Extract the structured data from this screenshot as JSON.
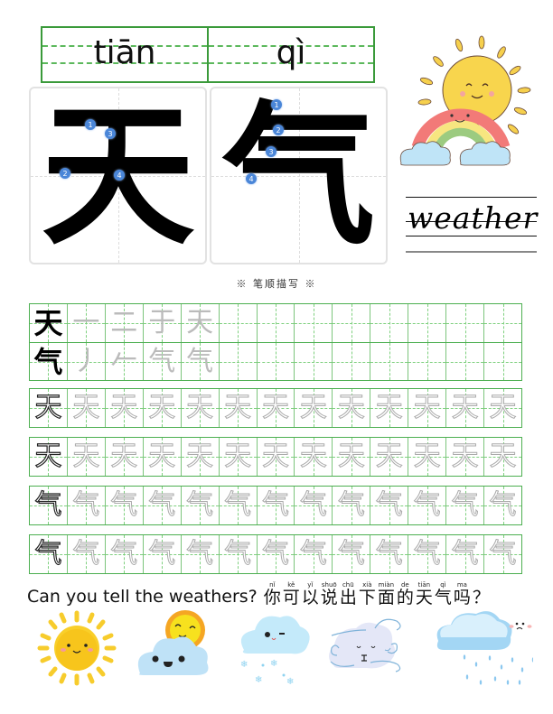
{
  "header": {
    "pinyin": [
      "tiān",
      "qì"
    ]
  },
  "stroke_order": {
    "characters": [
      {
        "char": "天",
        "badges": [
          "1",
          "2",
          "3",
          "4"
        ]
      },
      {
        "char": "气",
        "badges": [
          "1",
          "2",
          "3",
          "4"
        ]
      }
    ],
    "note": "※ 笔顺描写 ※"
  },
  "illustration": {
    "top_right": "sun-over-rainbow-with-clouds"
  },
  "english_word": "weather",
  "practice": {
    "stroke_rows": [
      {
        "char": "天",
        "steps": [
          "一",
          "二",
          "于",
          "天"
        ]
      },
      {
        "char": "气",
        "steps": [
          "丿",
          "𠂉",
          "气",
          "气"
        ]
      }
    ],
    "trace_rows": [
      {
        "char": "天",
        "cells": 13
      },
      {
        "char": "天",
        "cells": 13
      },
      {
        "char": "气",
        "cells": 13
      },
      {
        "char": "气",
        "cells": 13
      }
    ],
    "columns": 13
  },
  "question": {
    "english": "Can you tell the weathers?",
    "chinese": [
      {
        "hz": "你",
        "py": "nǐ"
      },
      {
        "hz": "可",
        "py": "kě"
      },
      {
        "hz": "以",
        "py": "yǐ"
      },
      {
        "hz": "说",
        "py": "shuō"
      },
      {
        "hz": "出",
        "py": "chū"
      },
      {
        "hz": "下",
        "py": "xià"
      },
      {
        "hz": "面",
        "py": "miàn"
      },
      {
        "hz": "的",
        "py": "de"
      },
      {
        "hz": "天",
        "py": "tiān"
      },
      {
        "hz": "气",
        "py": "qì"
      },
      {
        "hz": "吗",
        "py": "ma"
      }
    ],
    "end_mark": "？"
  },
  "weather_icons": [
    "sunny",
    "partly-cloudy",
    "snowy",
    "windy",
    "rainy"
  ],
  "colors": {
    "grid_green": "#4caf50",
    "grid_dashed": "#7fd07f",
    "badge_blue": "#4a86d8",
    "stroke_guide_red": "#d03030"
  }
}
